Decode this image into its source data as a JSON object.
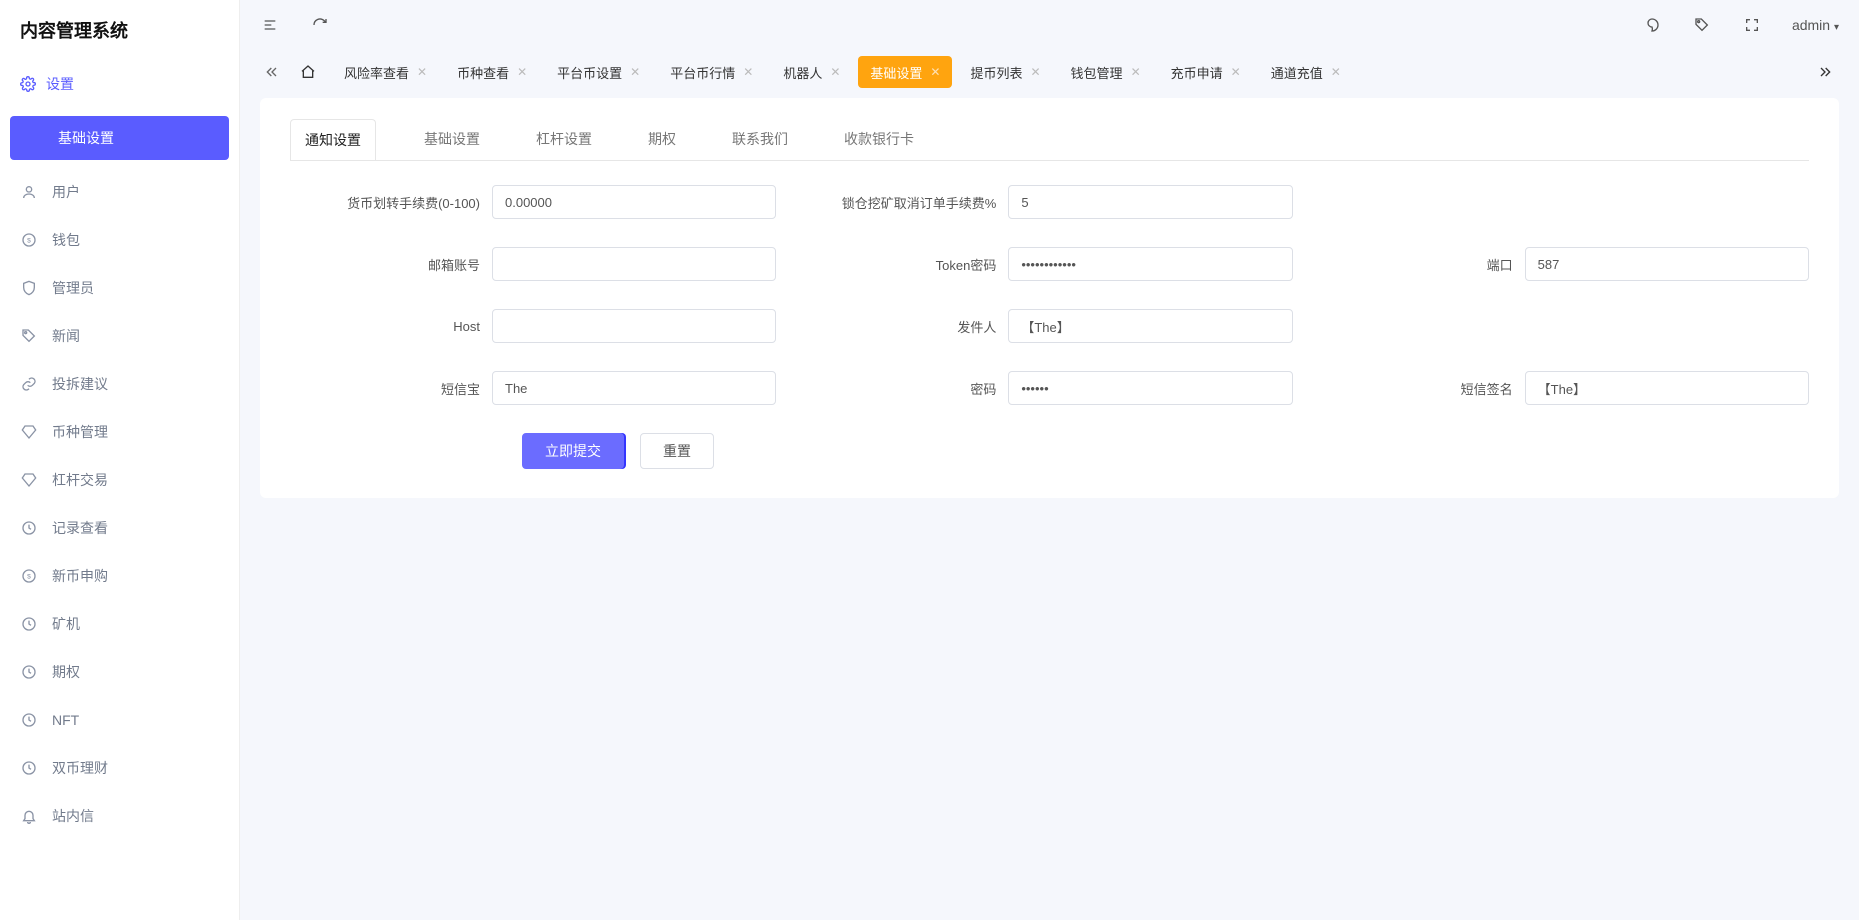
{
  "app": {
    "title": "内容管理系统",
    "user": "admin"
  },
  "sidebar": {
    "root_label": "设置",
    "active_label": "基础设置",
    "items": [
      {
        "label": "用户"
      },
      {
        "label": "钱包"
      },
      {
        "label": "管理员"
      },
      {
        "label": "新闻"
      },
      {
        "label": "投拆建议"
      },
      {
        "label": "币种管理"
      },
      {
        "label": "杠杆交易"
      },
      {
        "label": "记录查看"
      },
      {
        "label": "新币申购"
      },
      {
        "label": "矿机"
      },
      {
        "label": "期权"
      },
      {
        "label": "NFT"
      },
      {
        "label": "双币理财"
      },
      {
        "label": "站内信"
      }
    ]
  },
  "tabs": [
    {
      "label": "风险率查看"
    },
    {
      "label": "币种查看"
    },
    {
      "label": "平台币设置"
    },
    {
      "label": "平台币行情"
    },
    {
      "label": "机器人"
    },
    {
      "label": "基础设置",
      "active": true
    },
    {
      "label": "提币列表"
    },
    {
      "label": "钱包管理"
    },
    {
      "label": "充币申请"
    },
    {
      "label": "通道充值"
    }
  ],
  "inner_tabs": [
    {
      "label": "通知设置",
      "active": true
    },
    {
      "label": "基础设置"
    },
    {
      "label": "杠杆设置"
    },
    {
      "label": "期权"
    },
    {
      "label": "联系我们"
    },
    {
      "label": "收款银行卡"
    }
  ],
  "form": {
    "fee_label": "货币划转手续费(0-100)",
    "fee_value": "0.00000",
    "mining_cancel_fee_label": "锁仓挖矿取消订单手续费%",
    "mining_cancel_fee_value": "5",
    "email_account_label": "邮箱账号",
    "email_account_value": "",
    "token_pwd_label": "Token密码",
    "token_pwd_value": "••••••••••••",
    "port_label": "端口",
    "port_value": "587",
    "host_label": "Host",
    "host_value": "",
    "sender_label": "发件人",
    "sender_value": "【The】",
    "sms_label": "短信宝",
    "sms_value": "The",
    "pwd_label": "密码",
    "pwd_value": "••••••",
    "sms_sign_label": "短信签名",
    "sms_sign_value": "【The】",
    "submit_label": "立即提交",
    "reset_label": "重置"
  }
}
